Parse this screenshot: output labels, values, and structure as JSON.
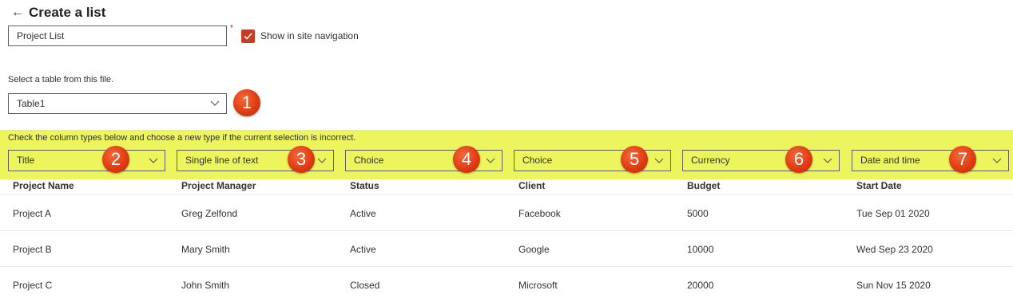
{
  "header": {
    "back_icon": "arrow-left-icon",
    "title": "Create a list"
  },
  "list_name": {
    "value": "Project List",
    "required_mark": "*"
  },
  "site_navigation": {
    "checked": true,
    "label": "Show in site navigation",
    "color": "#c73c22"
  },
  "table_select": {
    "label": "Select a table from this file.",
    "value": "Table1"
  },
  "column_types": {
    "instruction": "Check the column types below and choose a new type if the current selection is incorrect.",
    "highlight_color": "#ecf55c",
    "selects": [
      "Title",
      "Single line of text",
      "Choice",
      "Choice",
      "Currency",
      "Date and time"
    ]
  },
  "callouts": [
    "1",
    "2",
    "3",
    "4",
    "5",
    "6",
    "7"
  ],
  "table": {
    "columns": [
      "Project Name",
      "Project Manager",
      "Status",
      "Client",
      "Budget",
      "Start Date"
    ],
    "rows": [
      [
        "Project A",
        "Greg Zelfond",
        "Active",
        "Facebook",
        "5000",
        "Tue Sep 01 2020"
      ],
      [
        "Project B",
        "Mary Smith",
        "Active",
        "Google",
        "10000",
        "Wed Sep 23 2020"
      ],
      [
        "Project C",
        "John Smith",
        "Closed",
        "Microsoft",
        "20000",
        "Sun Nov 15 2020"
      ]
    ]
  }
}
